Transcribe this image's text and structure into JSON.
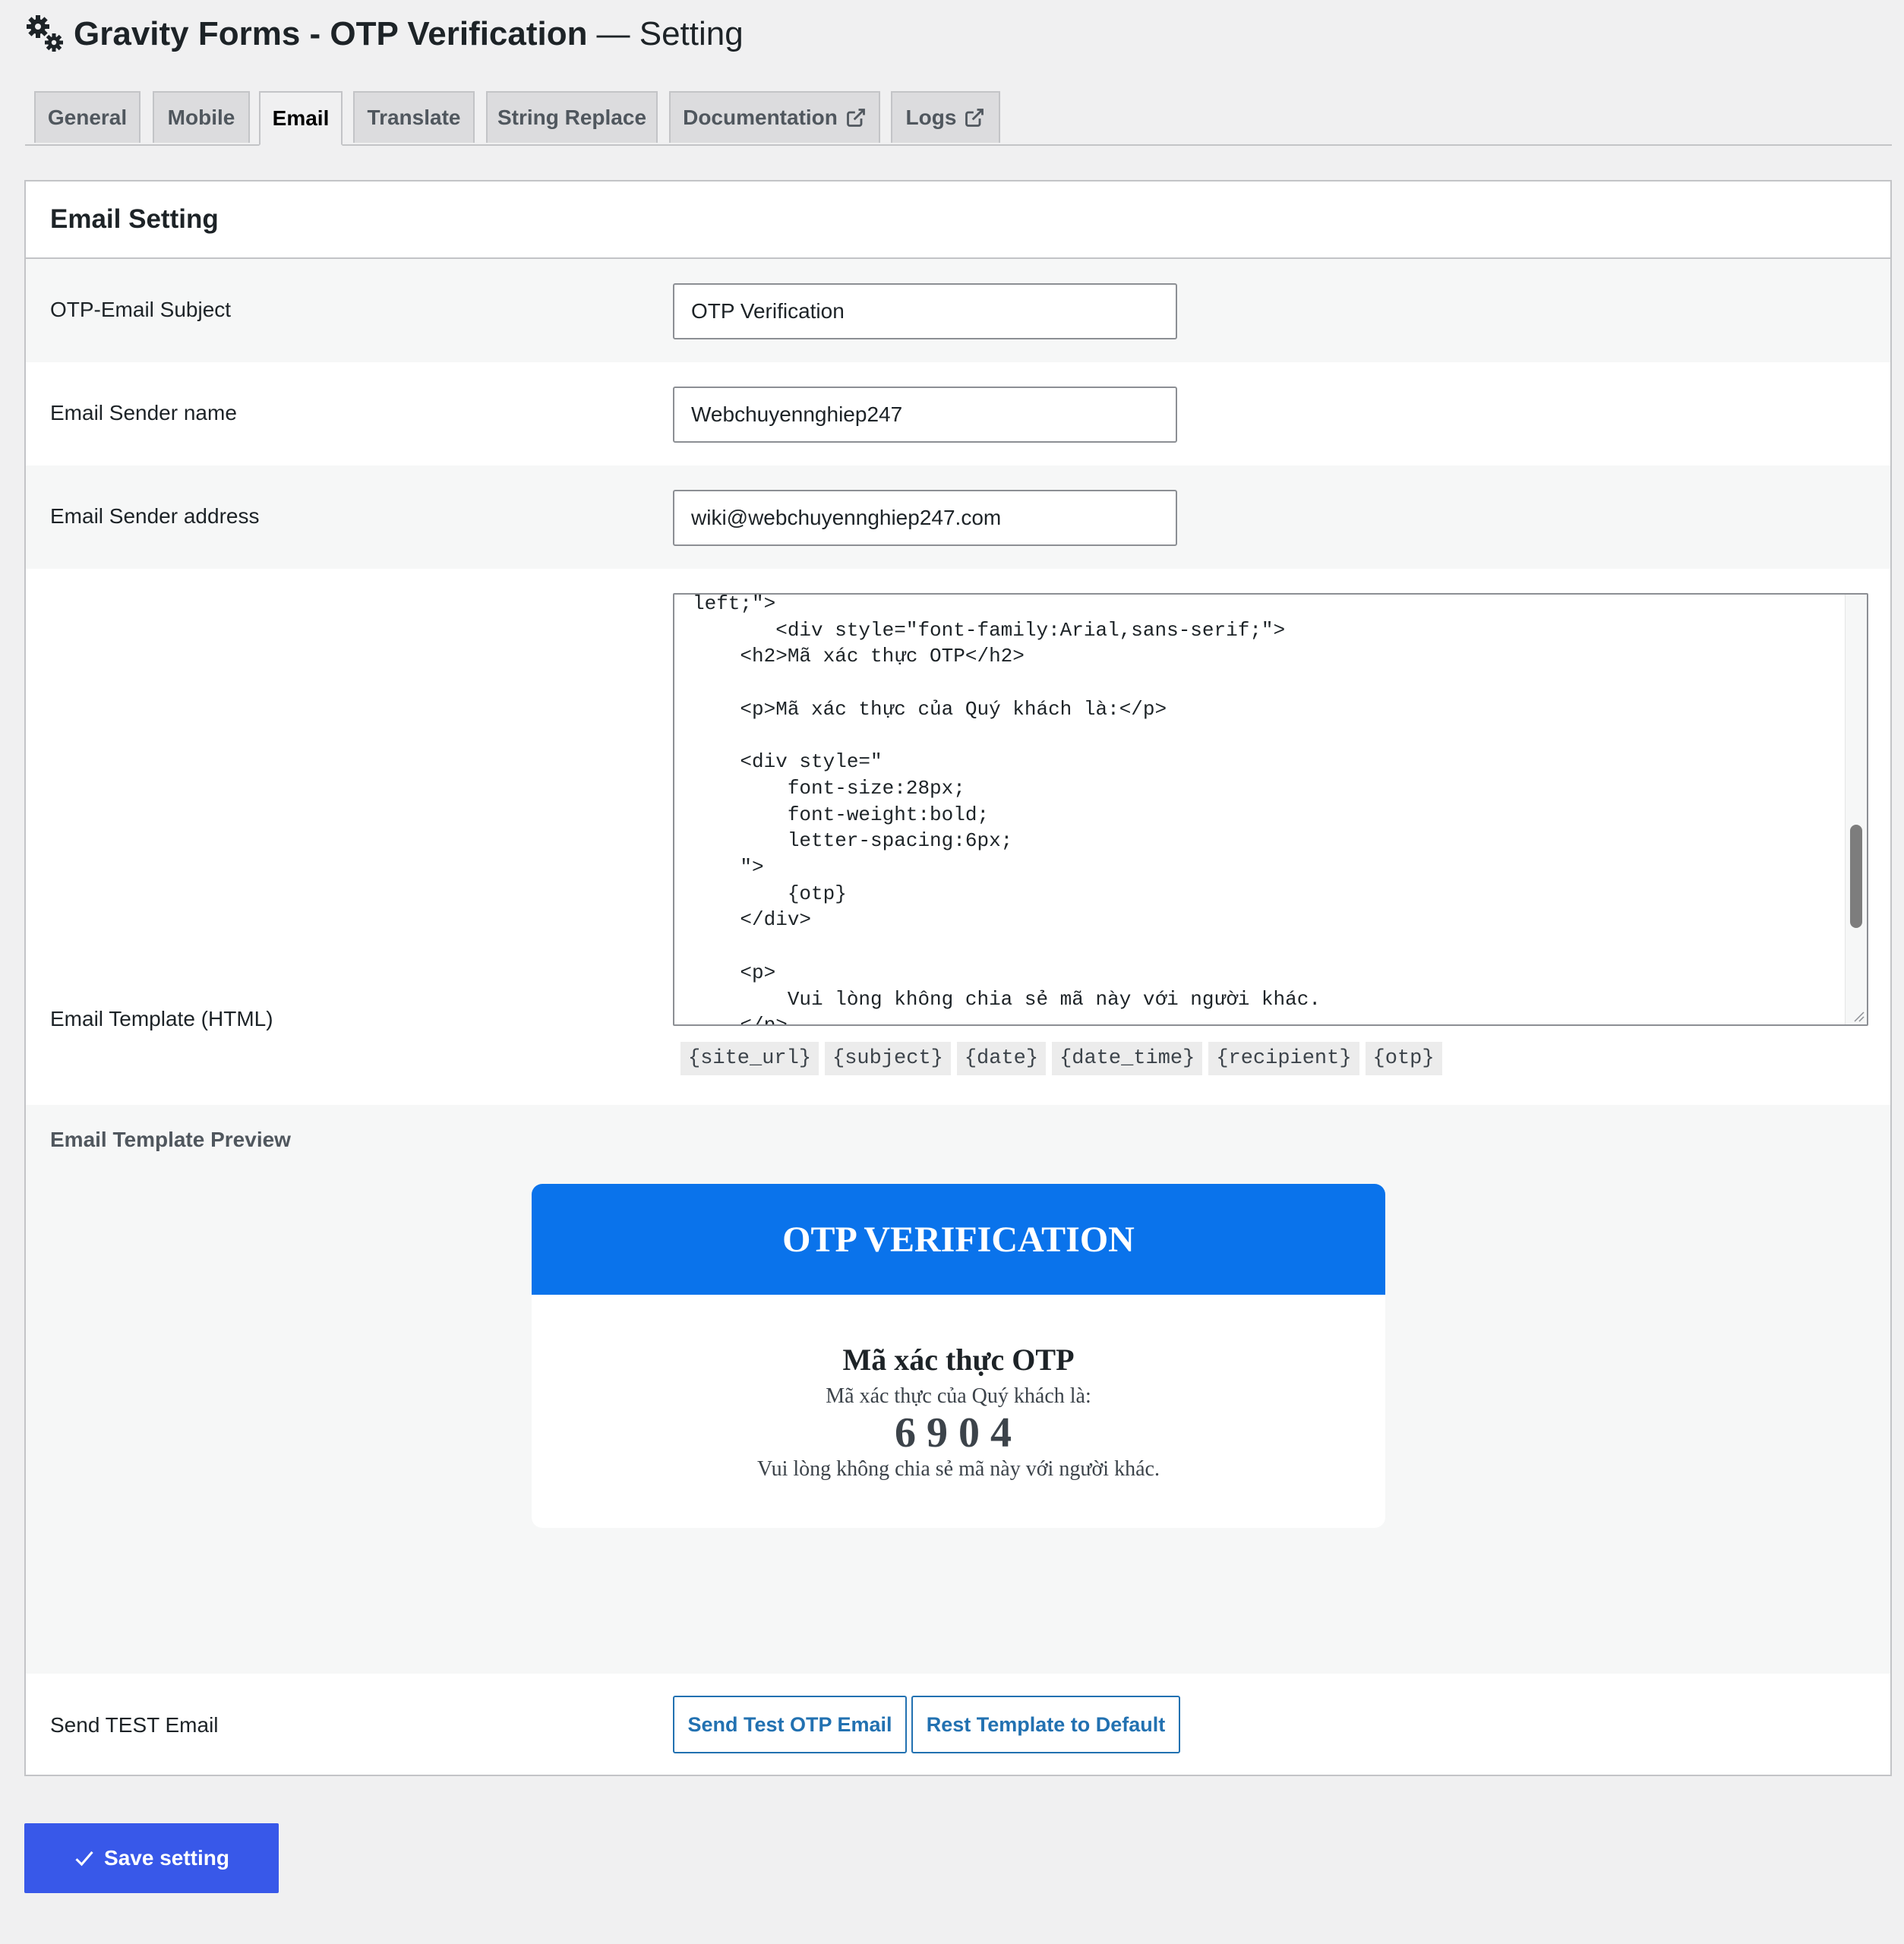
{
  "header": {
    "title": "Gravity Forms - OTP Verification",
    "subtitle": "— Setting",
    "icon": "gears-icon"
  },
  "tabs": [
    {
      "label": "General",
      "active": false,
      "external": false
    },
    {
      "label": "Mobile",
      "active": false,
      "external": false
    },
    {
      "label": "Email",
      "active": true,
      "external": false
    },
    {
      "label": "Translate",
      "active": false,
      "external": false
    },
    {
      "label": "String Replace",
      "active": false,
      "external": false
    },
    {
      "label": "Documentation",
      "active": false,
      "external": true
    },
    {
      "label": "Logs",
      "active": false,
      "external": true
    }
  ],
  "panel": {
    "title": "Email Setting",
    "subject_label": "OTP-Email Subject",
    "subject_value": "OTP Verification",
    "sender_name_label": "Email Sender name",
    "sender_name_value": "Webchuyennghiep247",
    "sender_address_label": "Email Sender address",
    "sender_address_value": "wiki@webchuyennghiep247.com",
    "template_label": "Email Template (HTML)",
    "template_code": "left;\">\n       <div style=\"font-family:Arial,sans-serif;\">\n    <h2>Mã xác thực OTP</h2>\n\n    <p>Mã xác thực của Quý khách là:</p>\n\n    <div style=\"\n        font-size:28px;\n        font-weight:bold;\n        letter-spacing:6px;\n    \">\n        {otp}\n    </div>\n\n    <p>\n        Vui lòng không chia sẻ mã này với người khác.\n    </p>",
    "placeholders": [
      "{site_url}",
      "{subject}",
      "{date}",
      "{date_time}",
      "{recipient}",
      "{otp}"
    ],
    "preview_label": "Email Template Preview",
    "test_label": "Send TEST Email",
    "send_test_button": "Send Test OTP Email",
    "reset_button": "Rest Template to Default"
  },
  "preview": {
    "banner": "OTP VERIFICATION",
    "heading": "Mã xác thực OTP",
    "intro": "Mã xác thực của Quý khách là:",
    "otp": "6904",
    "warning": "Vui lòng không chia sẻ mã này với người khác.",
    "banner_color": "#0a73eb"
  },
  "save_button": "Save setting",
  "colors": {
    "accent": "#3858e9",
    "link": "#2271b1"
  }
}
